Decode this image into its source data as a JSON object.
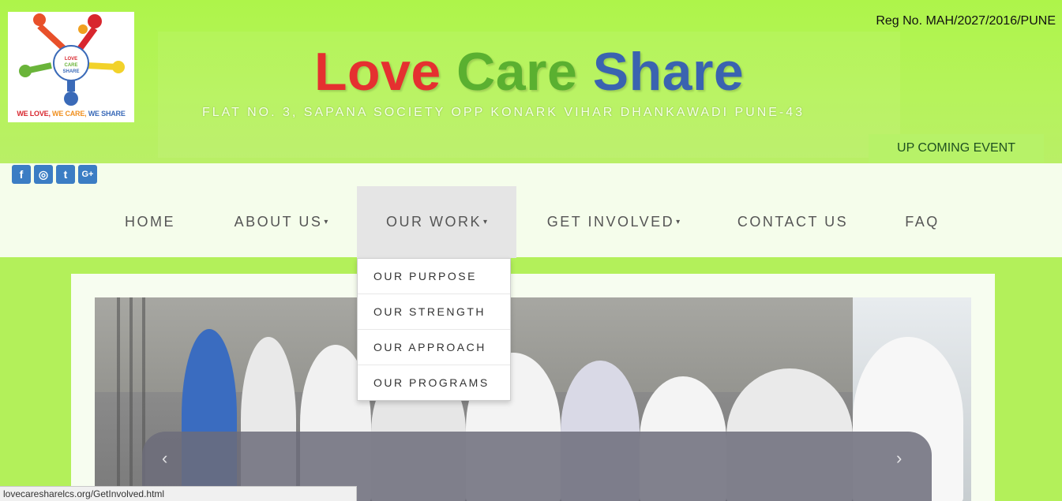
{
  "header": {
    "registration": "Reg No. MAH/2027/2016/PUNE",
    "brand": {
      "word1": "Love",
      "word2": "Care",
      "word3": "Share"
    },
    "address": "FLAT NO. 3, SAPANA SOCIETY OPP KONARK VIHAR DHANKAWADI PUNE-43",
    "event_button": "UP COMING EVENT",
    "logo": {
      "center_line1": "LOVE",
      "center_line2": "CARE",
      "center_line3": "SHARE",
      "tagline_love": "WE LOVE,",
      "tagline_care": " WE CARE,",
      "tagline_share": " WE SHARE"
    }
  },
  "social": {
    "facebook": "f",
    "instagram": "◎",
    "twitter": "t",
    "googleplus": "G+"
  },
  "nav": {
    "home": "HOME",
    "about": "ABOUT US",
    "work": "OUR WORK",
    "involved": "GET INVOLVED",
    "contact": "CONTACT US",
    "faq": "FAQ"
  },
  "dropdown": {
    "items": [
      "OUR PURPOSE",
      "OUR STRENGTH",
      "OUR APPROACH",
      "OUR PROGRAMS"
    ]
  },
  "carousel": {
    "prev": "‹",
    "next": "›"
  },
  "status_url": "lovecaresharelcs.org/GetInvolved.html",
  "colors": {
    "background": "#b3f05a",
    "love": "#e53030",
    "care": "#5ab030",
    "share": "#3a63b0",
    "social": "#3b7dc4"
  }
}
